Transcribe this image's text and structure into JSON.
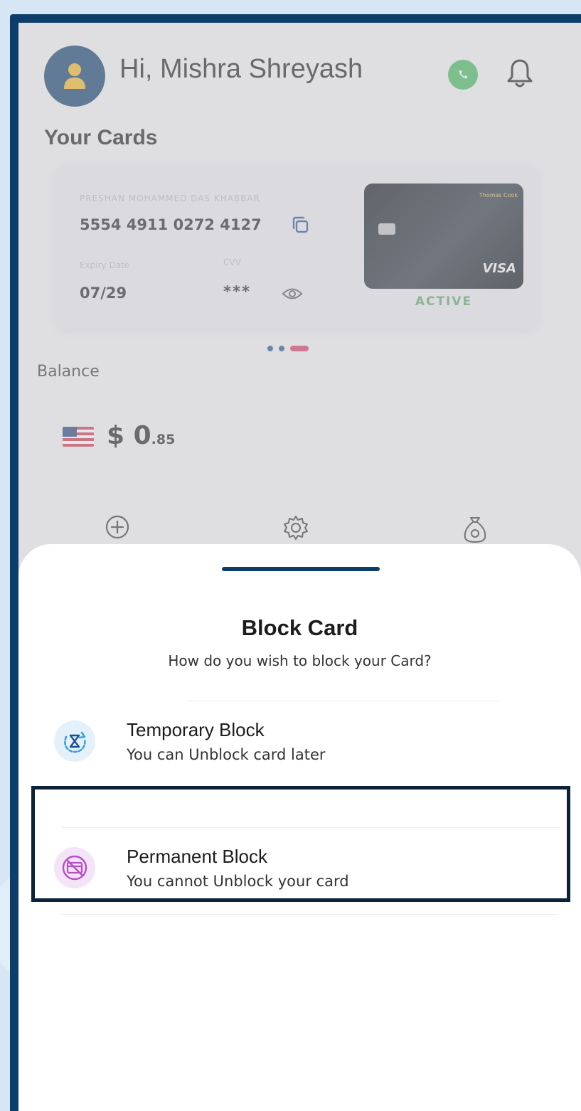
{
  "header": {
    "greeting": "Hi, Mishra Shreyash",
    "avatar_icon": "user-icon",
    "whatsapp_icon": "whatsapp-icon",
    "notification_icon": "bell-icon"
  },
  "cards_section": {
    "title": "Your Cards",
    "card_holder": "PRESHAN MOHAMMED DAS KHABBAR",
    "card_number": "5554 4911 0272 4127",
    "expiry_label": "Expiry Date",
    "expiry_value": "07/29",
    "cvv_label": "CVV",
    "cvv_value": "***",
    "card_brand": "Thomas Cook",
    "card_network": "VISA",
    "card_status": "ACTIVE",
    "pager_active_index": 2,
    "pager_count": 3
  },
  "balance": {
    "label": "Balance",
    "currency_symbol": "$",
    "amount_whole": "0",
    "amount_fraction": ".85",
    "flag": "us-flag"
  },
  "actions": {
    "icons": [
      "plus-circle-icon",
      "gear-icon",
      "money-bag-icon"
    ]
  },
  "sheet": {
    "title": "Block Card",
    "subtitle": "How do you wish to block your Card?",
    "options": [
      {
        "title": "Temporary Block",
        "description": "You can Unblock card later",
        "icon": "timer-icon"
      },
      {
        "title": "Permanent Block",
        "description": "You cannot Unblock your card",
        "icon": "blocked-card-icon"
      }
    ]
  },
  "colors": {
    "brand_navy": "#0d3d6b",
    "active_green": "#5ea46a",
    "pager_active": "#d6375d",
    "highlight_border": "#0b2238"
  }
}
